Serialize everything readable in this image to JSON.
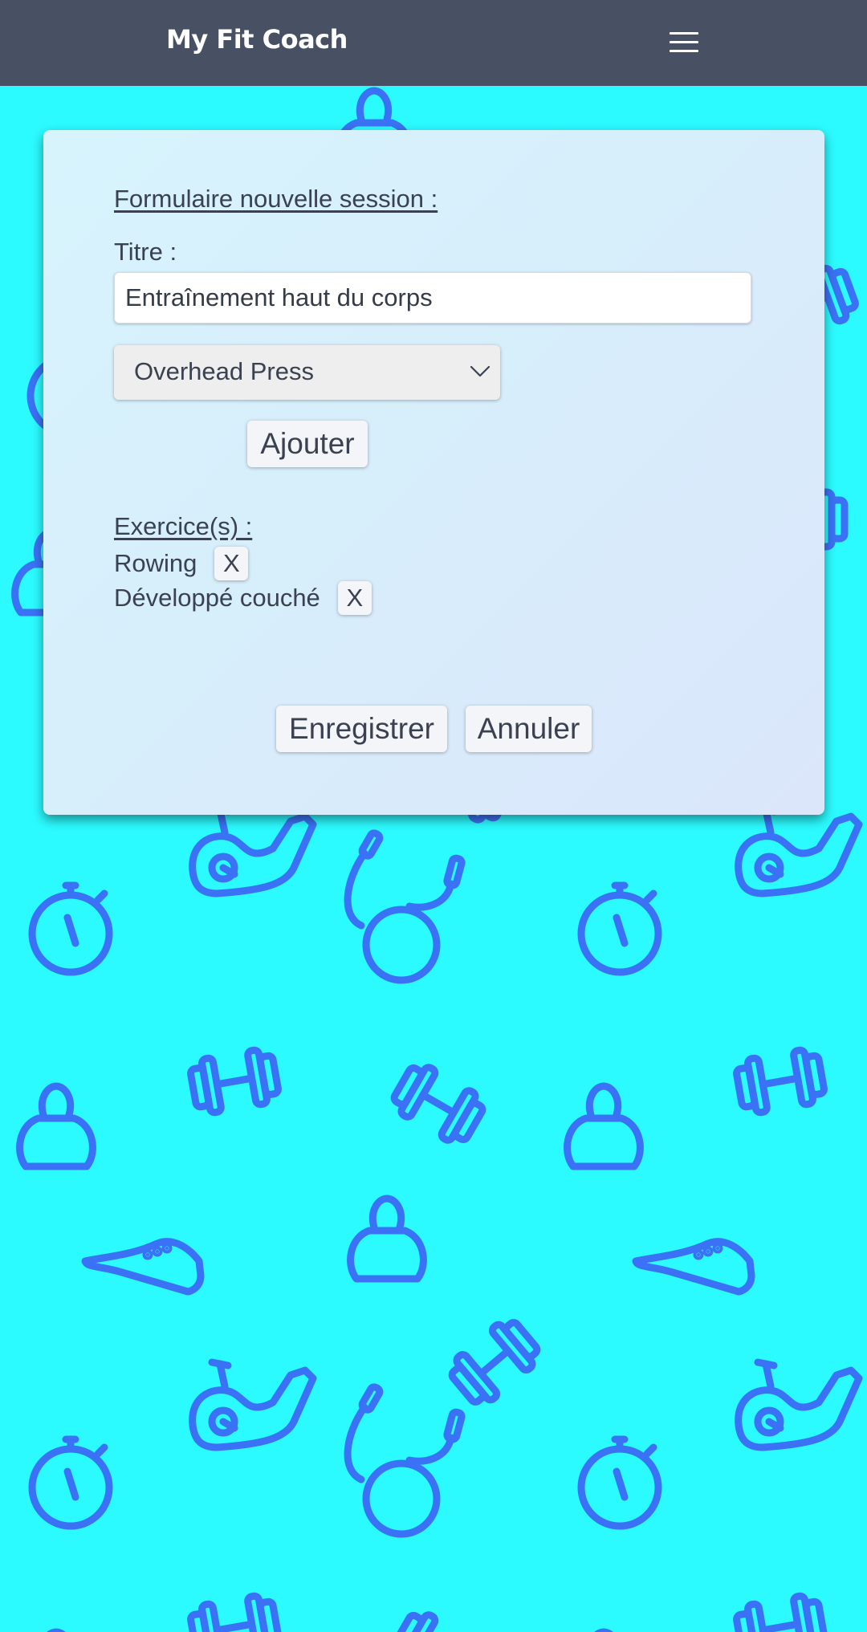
{
  "header": {
    "brand": "My Fit Coach",
    "menu_icon": "hamburger-menu-icon"
  },
  "colors": {
    "navbar": "#475163",
    "background": "#2bfbff",
    "pattern": "#3b72f5",
    "text": "#3a4150"
  },
  "background_icons": [
    "kettlebell-icon",
    "dumbbell-icon",
    "stopwatch-icon",
    "sneaker-icon",
    "exercise-bike-icon",
    "jump-rope-icon"
  ],
  "form": {
    "heading": "Formulaire nouvelle session :",
    "title_label": "Titre :",
    "title_value": "Entraînement haut du corps",
    "exercise_select": {
      "selected": "Overhead Press"
    },
    "add_button": "Ajouter",
    "exercises_heading": "Exercice(s) :",
    "exercises": [
      {
        "name": "Rowing",
        "remove_label": "X"
      },
      {
        "name": "Développé couché",
        "remove_label": "X"
      }
    ],
    "save_button": "Enregistrer",
    "cancel_button": "Annuler"
  }
}
